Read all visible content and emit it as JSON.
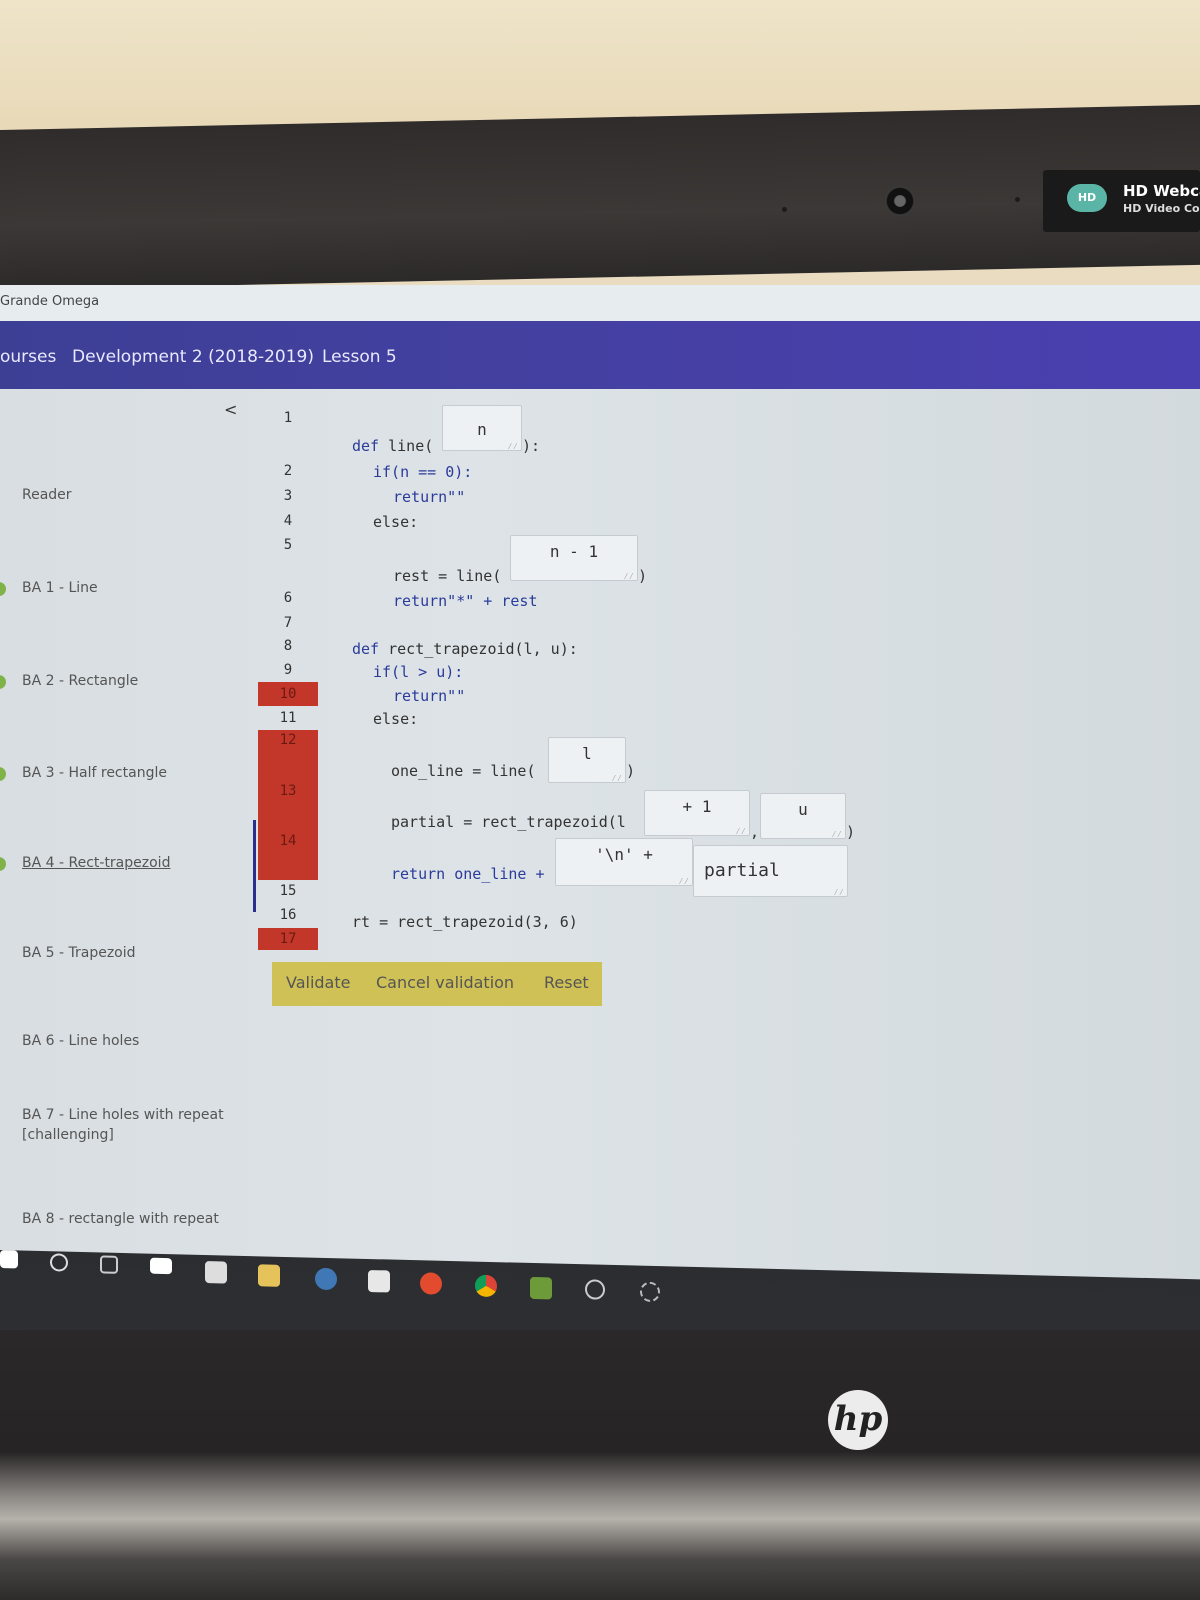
{
  "window": {
    "title": "Grande Omega"
  },
  "device": {
    "webcam_title": "HD Webca",
    "webcam_subtitle": "HD Video Con",
    "webcam_logo": "HD",
    "brand": "hp"
  },
  "nav": {
    "items": [
      "ourses",
      "Development 2 (2018-2019)",
      "Lesson 5"
    ]
  },
  "sidebar": {
    "collapse_icon": "<",
    "items": [
      {
        "label": "Reader",
        "status": "done"
      },
      {
        "label": "BA 1 - Line",
        "status": "done"
      },
      {
        "label": "BA 2 - Rectangle",
        "status": "done"
      },
      {
        "label": "BA 3 - Half rectangle",
        "status": "done"
      },
      {
        "label": "BA 4 - Rect-trapezoid",
        "status": "current"
      },
      {
        "label": "BA 5 - Trapezoid",
        "status": "todo"
      },
      {
        "label": "BA 6 - Line holes",
        "status": "todo"
      },
      {
        "label": "BA 7 - Line holes with repeat",
        "label2": "[challenging]",
        "status": "todo"
      },
      {
        "label": "BA 8 - rectangle with repeat",
        "status": "todo"
      }
    ]
  },
  "editor": {
    "line_numbers": [
      "1",
      "2",
      "3",
      "4",
      "5",
      "6",
      "7",
      "8",
      "9",
      "10",
      "11",
      "12",
      "13",
      "14",
      "15",
      "16",
      "17"
    ],
    "error_lines": [
      "10",
      "12",
      "13",
      "14",
      "17"
    ],
    "code": {
      "l1_kw": "def",
      "l1": " line(",
      "l1_end": "):",
      "l2": "if(n == 0):",
      "l3": "return\"\"",
      "l4": "else:",
      "l5": "rest = line(",
      "l5_end": ")",
      "l6": "return\"*\" + rest",
      "l8_kw": "def",
      "l8": " rect_trapezoid(l, u):",
      "l9": "if(l > u):",
      "l10": "return\"\"",
      "l11": "else:",
      "l12": "one_line = line(",
      "l12_end": ")",
      "l13": "partial = rect_trapezoid(l",
      "l13_comma": ",",
      "l13_end": ")",
      "l14": "return one_line +",
      "l16": "rt = rect_trapezoid(3, 6)"
    },
    "fields": {
      "f1": "n",
      "f2": "n - 1",
      "f3": "l",
      "f4": "+ 1",
      "f5": "u",
      "f6": "'\\n' +",
      "f7": "partial"
    }
  },
  "buttons": {
    "validate": "Validate",
    "cancel": "Cancel validation",
    "reset": "Reset"
  },
  "colors": {
    "nav": "#4640a5",
    "error": "#c2372a",
    "done": "#7fb34a",
    "buttonbar": "#cfc156"
  },
  "taskbar": {
    "icons": [
      "windows-icon",
      "search-icon",
      "task-view-icon",
      "mail-icon",
      "calendar-icon",
      "file-explorer-icon",
      "python-icon",
      "notepad-icon",
      "app-icon",
      "chrome-icon",
      "minecraft-icon",
      "p-icon",
      "settings-icon"
    ]
  }
}
